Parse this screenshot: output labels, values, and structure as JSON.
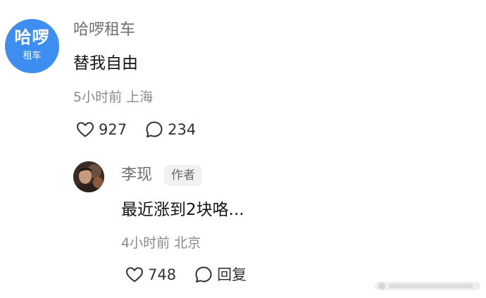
{
  "comment": {
    "avatar": {
      "brand_top": "哈啰",
      "brand_bottom": "租车",
      "color": "#3d8ef0"
    },
    "username": "哈啰租车",
    "text": "替我自由",
    "time": "5小时前",
    "location": "上海",
    "likes": "927",
    "replies": "234"
  },
  "reply": {
    "username": "李现",
    "badge": "作者",
    "text": "最近涨到2块咯...",
    "time": "4小时前",
    "location": "北京",
    "likes": "748",
    "reply_label": "回复"
  },
  "icons": {
    "like": "heart-outline-icon",
    "comment": "speech-bubble-icon"
  }
}
